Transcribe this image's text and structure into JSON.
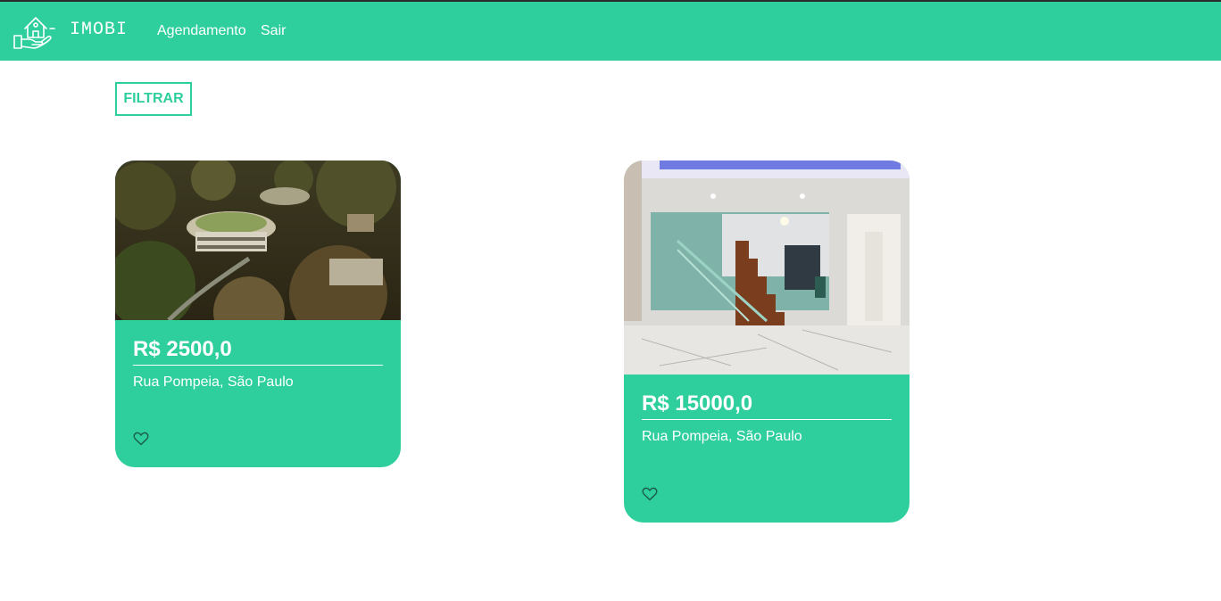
{
  "header": {
    "brand": "IMOBI",
    "nav": [
      "Agendamento",
      "Sair"
    ],
    "logo_icon": "house-hand-icon"
  },
  "toolbar": {
    "filter_label": "FILTRAR"
  },
  "listings": [
    {
      "price": "R$ 2500,0",
      "address": "Rua Pompeia, São Paulo",
      "photo": "aerial view of modern house in forest",
      "favorite_icon": "heart-icon"
    },
    {
      "price": "R$ 15000,0",
      "address": "Rua Pompeia, São Paulo",
      "photo": "interior with marble floor and glass staircase",
      "favorite_icon": "heart-icon"
    }
  ],
  "colors": {
    "accent": "#2ecf9d",
    "text_on_accent": "#ffffff"
  }
}
